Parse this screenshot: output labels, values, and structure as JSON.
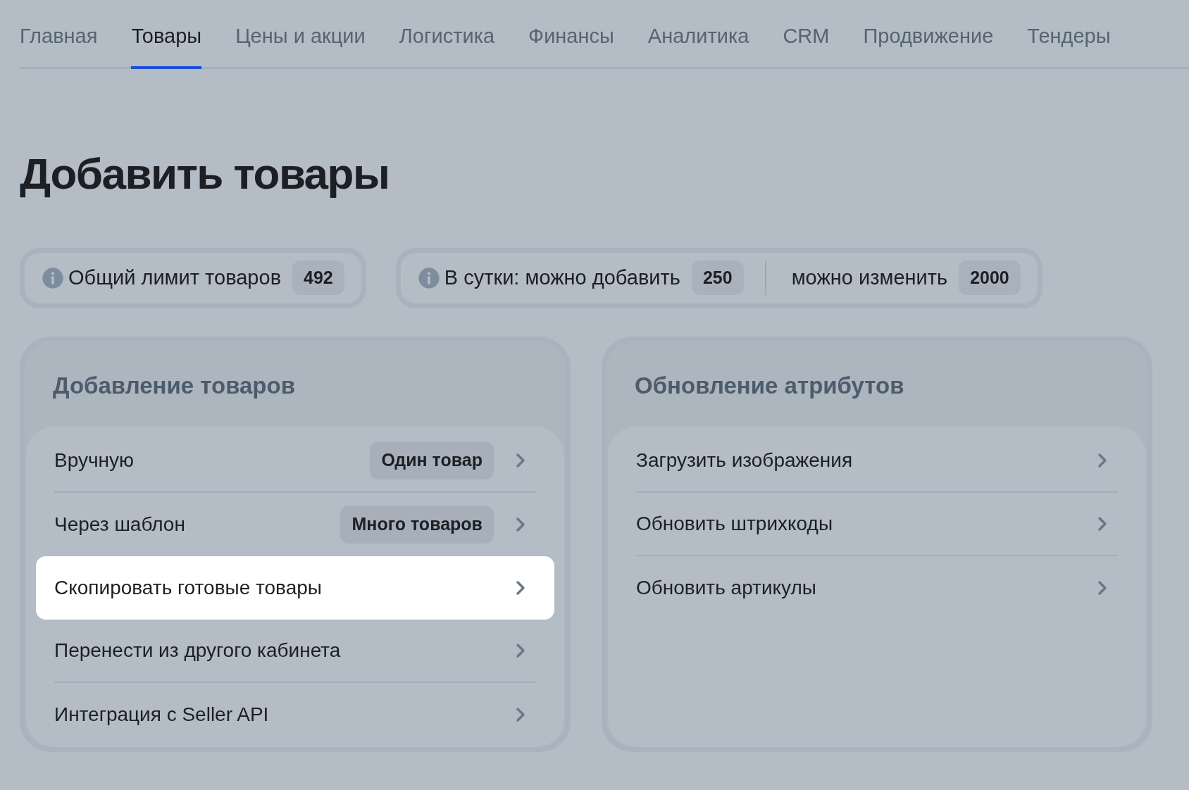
{
  "tabs": [
    {
      "label": "Главная",
      "selected": false
    },
    {
      "label": "Товары",
      "selected": true
    },
    {
      "label": "Цены и акции",
      "selected": false
    },
    {
      "label": "Логистика",
      "selected": false
    },
    {
      "label": "Финансы",
      "selected": false
    },
    {
      "label": "Аналитика",
      "selected": false
    },
    {
      "label": "CRM",
      "selected": false
    },
    {
      "label": "Продвижение",
      "selected": false
    },
    {
      "label": "Тендеры",
      "selected": false
    }
  ],
  "title": "Добавить товары",
  "limits": [
    {
      "parts": [
        {
          "label": "Общий лимит товаров",
          "count": "492"
        }
      ]
    },
    {
      "parts": [
        {
          "label": "В сутки: можно добавить",
          "count": "250"
        },
        {
          "label": "можно изменить",
          "count": "2000"
        }
      ]
    }
  ],
  "sections": [
    {
      "title": "Добавление товаров",
      "items": [
        {
          "label": "Вручную",
          "badge": "Один товар",
          "selected": false
        },
        {
          "label": "Через шаблон",
          "badge": "Много товаров",
          "selected": false
        },
        {
          "label": "Скопировать готовые товары",
          "selected": true
        },
        {
          "label": "Перенести из другого кабинета",
          "selected": false
        },
        {
          "label": "Интеграция с Seller API",
          "selected": false
        }
      ]
    },
    {
      "title": "Обновление атрибутов",
      "items": [
        {
          "label": "Загрузить изображения",
          "selected": false
        },
        {
          "label": "Обновить штрихкоды",
          "selected": false
        },
        {
          "label": "Обновить артикулы",
          "selected": false
        }
      ]
    }
  ]
}
